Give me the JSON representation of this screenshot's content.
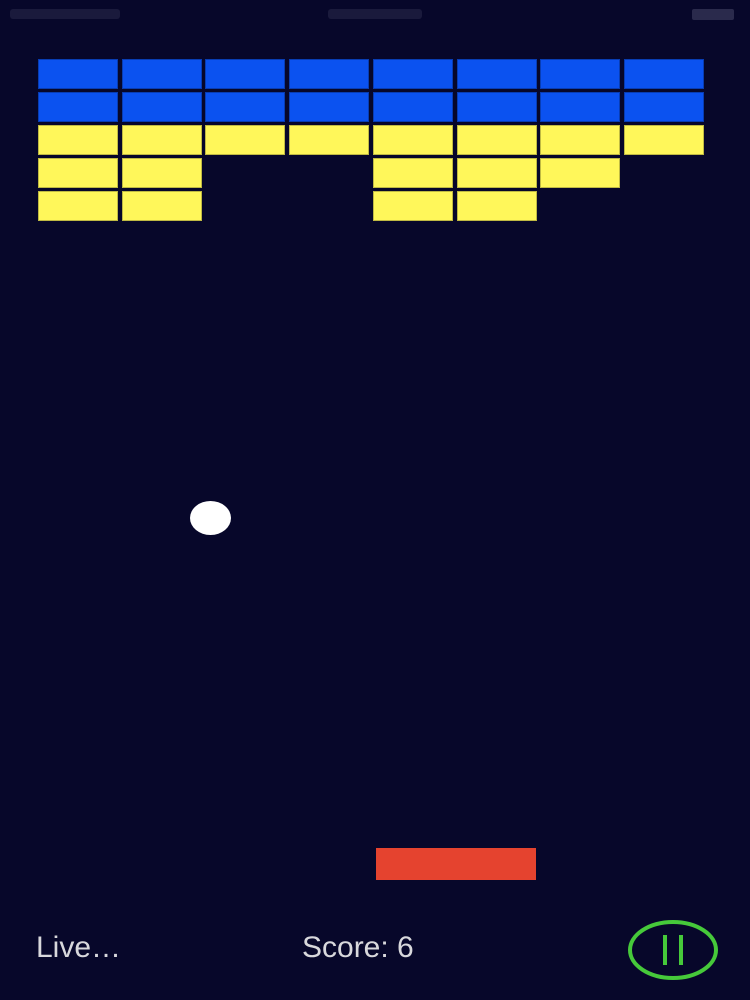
{
  "colors": {
    "background": "#07072a",
    "brick_blue": "#0b52f0",
    "brick_yellow": "#fff75a",
    "ball": "#ffffff",
    "paddle": "#e5432f",
    "pause_button": "#46c93a",
    "hud_text": "#d8d8dc"
  },
  "bricks": {
    "columns": 8,
    "rows": [
      [
        "blue",
        "blue",
        "blue",
        "blue",
        "blue",
        "blue",
        "blue",
        "blue"
      ],
      [
        "blue",
        "blue",
        "blue",
        "blue",
        "blue",
        "blue",
        "blue",
        "blue"
      ],
      [
        "yellow",
        "yellow",
        "yellow",
        "yellow",
        "yellow",
        "yellow",
        "yellow",
        "yellow"
      ],
      [
        "yellow",
        "yellow",
        null,
        null,
        "yellow",
        "yellow",
        "yellow",
        null
      ],
      [
        "yellow",
        "yellow",
        null,
        null,
        "yellow",
        "yellow",
        null,
        null
      ]
    ]
  },
  "hud": {
    "lives_label": "Live…",
    "score_label": "Score: 6",
    "pause_icon": "pause-icon"
  }
}
